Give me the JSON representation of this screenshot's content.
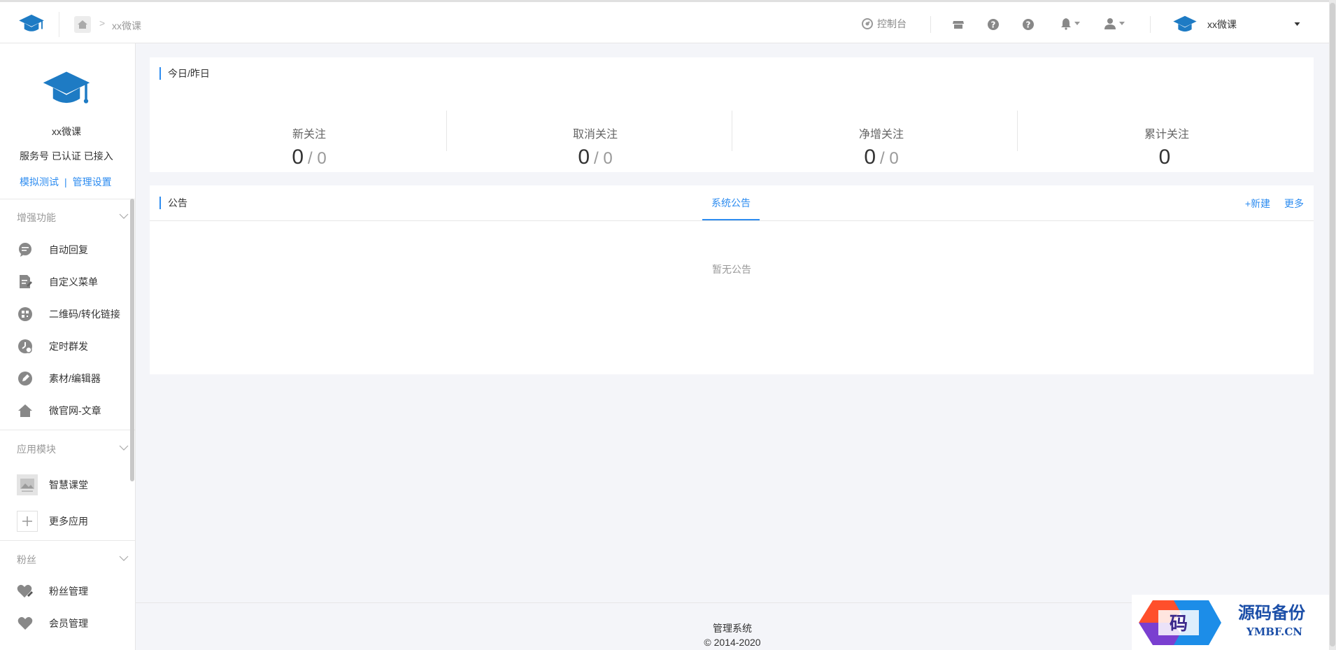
{
  "header": {
    "breadcrumb": "xx微课",
    "console_label": "控制台",
    "account_name": "xx微课",
    "icons": [
      "home-icon",
      "dashboard-icon",
      "store-icon",
      "help-icon",
      "question-icon",
      "bell-icon",
      "user-icon",
      "caret-down-icon"
    ]
  },
  "sidebar": {
    "name": "xx微课",
    "meta": "服务号 已认证 已接入",
    "link_test": "模拟测试",
    "link_sep": "|",
    "link_settings": "管理设置",
    "groups": [
      {
        "title": "增强功能",
        "items": [
          {
            "label": "自动回复",
            "icon": "chat-icon"
          },
          {
            "label": "自定义菜单",
            "icon": "edit-doc-icon"
          },
          {
            "label": "二维码/转化链接",
            "icon": "qrcode-icon"
          },
          {
            "label": "定时群发",
            "icon": "clock-icon"
          },
          {
            "label": "素材/编辑器",
            "icon": "pencil-icon"
          },
          {
            "label": "微官网-文章",
            "icon": "house-icon"
          }
        ]
      },
      {
        "title": "应用模块",
        "items": [
          {
            "label": "智慧课堂",
            "icon": "image-icon"
          },
          {
            "label": "更多应用",
            "icon": "plus-icon"
          }
        ]
      },
      {
        "title": "粉丝",
        "items": [
          {
            "label": "粉丝管理",
            "icon": "heart-edit-icon"
          },
          {
            "label": "会员管理",
            "icon": "heart-icon"
          }
        ]
      }
    ]
  },
  "stats": {
    "title": "今日/昨日",
    "items": [
      {
        "label": "新关注",
        "today": "0",
        "yesterday": "/ 0"
      },
      {
        "label": "取消关注",
        "today": "0",
        "yesterday": "/ 0"
      },
      {
        "label": "净增关注",
        "today": "0",
        "yesterday": "/ 0"
      },
      {
        "label": "累计关注",
        "today": "0",
        "yesterday": ""
      }
    ]
  },
  "notice": {
    "title": "公告",
    "tab": "系统公告",
    "new_label": "+新建",
    "more_label": "更多",
    "empty": "暂无公告"
  },
  "footer": {
    "line1": "管理系统",
    "line2": "© 2014-2020"
  },
  "colors": {
    "accent": "#2d8cf0",
    "logo_blue": "#1e7bc4",
    "background": "#f4f5f9"
  }
}
